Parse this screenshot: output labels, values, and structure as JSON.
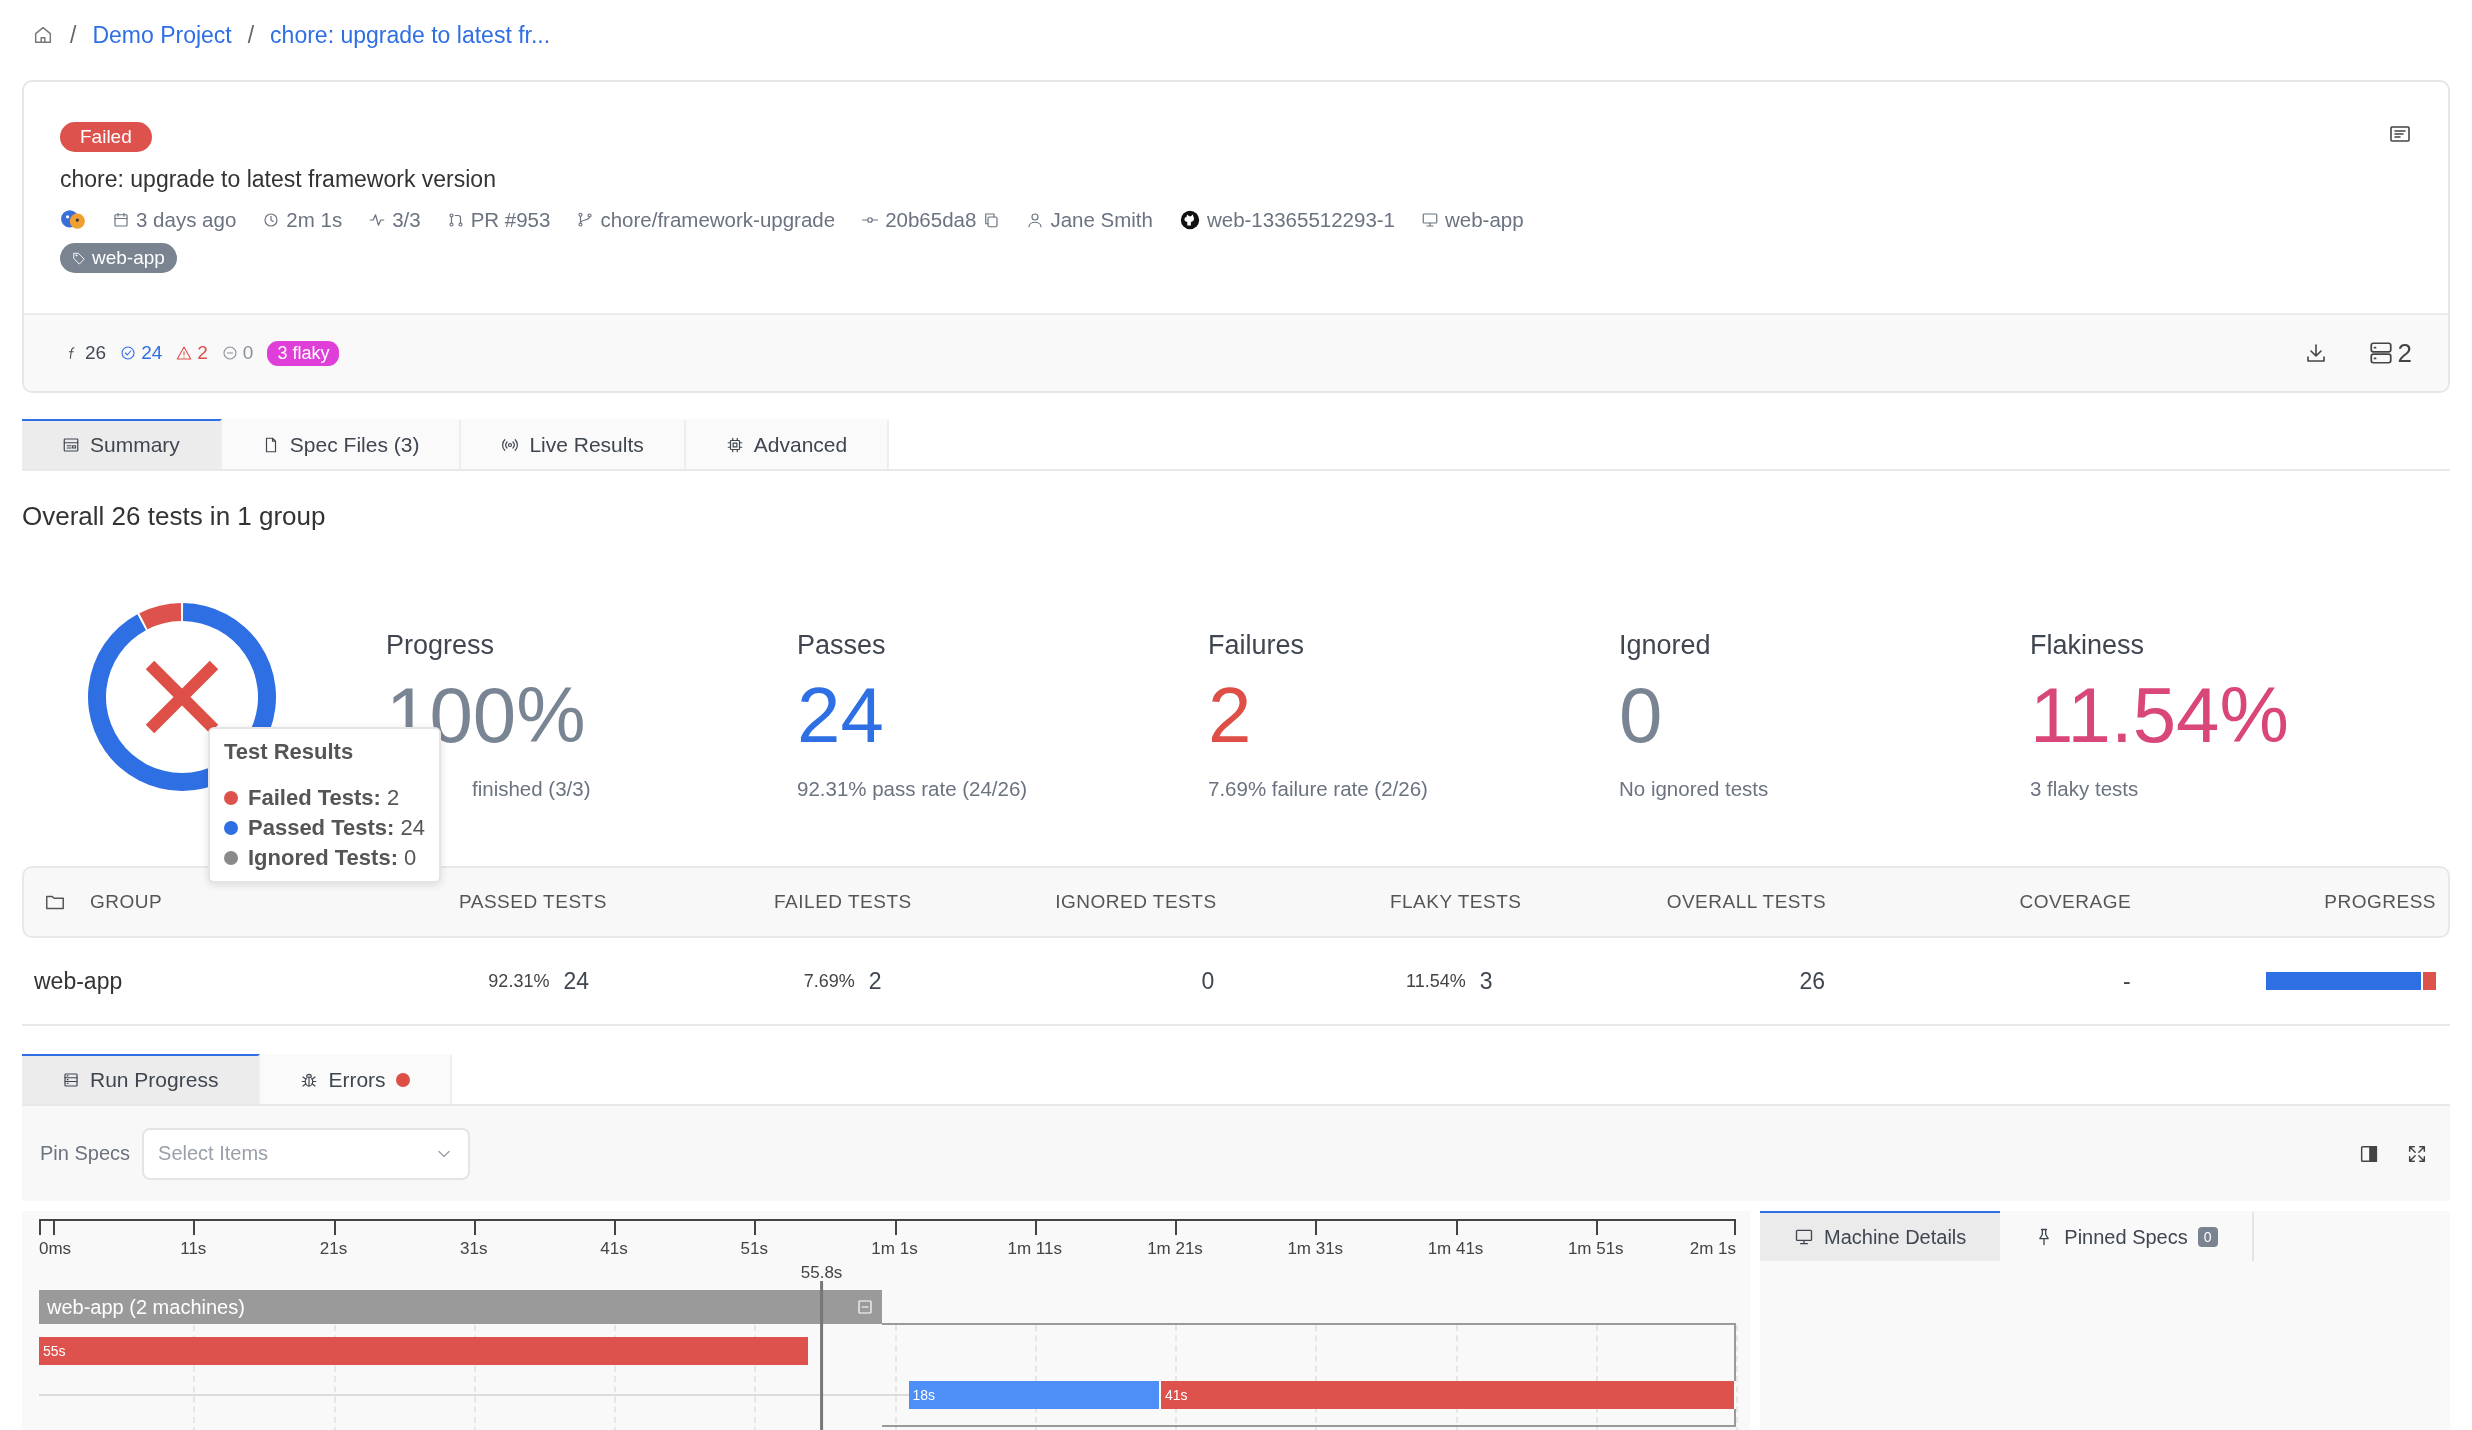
{
  "breadcrumb": [
    {
      "kind": "home"
    },
    {
      "kind": "separator",
      "text": "/"
    },
    {
      "kind": "link",
      "text": "Demo Project"
    },
    {
      "kind": "separator",
      "text": "/"
    },
    {
      "kind": "link",
      "text": "chore: upgrade to latest fr..."
    }
  ],
  "run": {
    "status": {
      "label": "Failed",
      "kind": "failed"
    },
    "title": "chore: upgrade to latest framework version",
    "meta": [
      {
        "kind": "avatar"
      },
      {
        "kind": "calendar",
        "text": "3 days ago"
      },
      {
        "kind": "clock",
        "text": "2m 1s"
      },
      {
        "kind": "activity",
        "text": "3/3"
      },
      {
        "kind": "pull-request",
        "text": "PR #953"
      },
      {
        "kind": "branch",
        "text": "chore/framework-upgrade"
      },
      {
        "kind": "commit",
        "text": "20b65da8"
      },
      {
        "kind": "user",
        "text": "Jane Smith"
      },
      {
        "kind": "github",
        "text": "web-13365512293-1"
      },
      {
        "kind": "monitor",
        "text": "web-app"
      }
    ],
    "tags": [
      "web-app"
    ],
    "counts": [
      {
        "kind": "total",
        "text": "26"
      },
      {
        "kind": "passed",
        "text": "24"
      },
      {
        "kind": "failed",
        "text": "2"
      },
      {
        "kind": "skipped",
        "text": "0"
      },
      {
        "kind": "flaky",
        "text": "3 flaky"
      }
    ],
    "machines": "2"
  },
  "tabs": [
    {
      "label": "Summary",
      "kind": "summary",
      "selected": true
    },
    {
      "label": "Spec Files (3)",
      "kind": "file",
      "selected": false
    },
    {
      "label": "Live Results",
      "kind": "live",
      "selected": false
    },
    {
      "label": "Advanced",
      "kind": "chip",
      "selected": false
    }
  ],
  "summary_heading": "Overall 26 tests in 1 group",
  "donut": {
    "chart_data": {
      "type": "donut",
      "categories": [
        "Failed Tests",
        "Passed Tests",
        "Ignored Tests"
      ],
      "values": [
        7.69,
        92.31,
        0
      ]
    }
  },
  "tooltip": {
    "title": "Test Results",
    "items": [
      {
        "sep": ":",
        "value": "2",
        "color": "#dd524c"
      },
      {
        "sep": ":",
        "value": "24",
        "color": "#2f6fe4"
      },
      {
        "sep": ":",
        "value": "0",
        "color": "#8a8a8a"
      }
    ]
  },
  "stats": [
    {
      "kind": "progress",
      "label": "Progress",
      "value": "100%",
      "detail": "finished (3/3)"
    },
    {
      "kind": "passes",
      "label": "Passes",
      "value": "24",
      "detail": "92.31% pass rate (24/26)"
    },
    {
      "kind": "failures",
      "label": "Failures",
      "value": "2",
      "detail": "7.69% failure rate (2/26)"
    },
    {
      "kind": "ignored",
      "label": "Ignored",
      "value": "0",
      "detail": "No ignored tests"
    },
    {
      "kind": "flakiness",
      "label": "Flakiness",
      "value": "11.54%",
      "detail": "3 flaky tests"
    }
  ],
  "table": {
    "columns": [
      {
        "kind": "group",
        "label": "GROUP"
      },
      {
        "kind": "value",
        "label": "PASSED TESTS"
      },
      {
        "kind": "value",
        "label": "FAILED TESTS"
      },
      {
        "kind": "value",
        "label": "IGNORED TESTS"
      },
      {
        "kind": "value",
        "label": "FLAKY TESTS"
      },
      {
        "kind": "value",
        "label": "OVERALL TESTS"
      },
      {
        "kind": "value",
        "label": "COVERAGE"
      },
      {
        "kind": "value",
        "label": "PROGRESS"
      }
    ],
    "rows": [
      {
        "cells": [
          {
            "kind": "name",
            "text": "web-app"
          },
          {
            "kind": "rate",
            "percent": "92.31%",
            "count": "24"
          },
          {
            "kind": "rate",
            "percent": "7.69%",
            "count": "2"
          },
          {
            "kind": "count",
            "text": "0"
          },
          {
            "kind": "rate",
            "percent": "11.54%",
            "count": "3"
          },
          {
            "kind": "count",
            "text": "26"
          },
          {
            "kind": "count",
            "text": "-"
          },
          {
            "kind": "progress",
            "segments": [
              {
                "level": 0.923,
                "color": "#2f6fe4"
              },
              {
                "level": 0.077,
                "color": "#dd524c"
              }
            ]
          }
        ]
      }
    ]
  },
  "bottom_tabs": [
    {
      "label": "Run Progress",
      "kind": "progress",
      "selected": true,
      "alert": false
    },
    {
      "label": "Errors",
      "kind": "errors",
      "selected": false,
      "alert": true
    }
  ],
  "pin_specs": {
    "label": "Pin Specs",
    "placeholder": "Select Items"
  },
  "timeline": {
    "group": {
      "label": "web-app (2 machines)",
      "expanded": true
    },
    "chart_data": {
      "type": "bar",
      "orientation": "horizontal",
      "stacked": true,
      "grid": true,
      "xlim": [
        0,
        121
      ],
      "xticks": [
        {
          "value": 0,
          "label": "0ms"
        },
        {
          "value": 11,
          "label": "11s"
        },
        {
          "value": 21,
          "label": "21s"
        },
        {
          "value": 31,
          "label": "31s"
        },
        {
          "value": 41,
          "label": "41s"
        },
        {
          "value": 51,
          "label": "51s"
        },
        {
          "value": 61,
          "label": "1m 1s"
        },
        {
          "value": 71,
          "label": "1m 11s"
        },
        {
          "value": 81,
          "label": "1m 21s"
        },
        {
          "value": 91,
          "label": "1m 31s"
        },
        {
          "value": 101,
          "label": "1m 41s"
        },
        {
          "value": 111,
          "label": "1m 51s"
        },
        {
          "value": 121,
          "label": "2m 1s"
        }
      ],
      "series": [
        {
          "color": "#dcdcdc",
          "values": [
            null,
            62
          ]
        },
        {
          "color": "#4e8ef7",
          "values": [
            null,
            18
          ]
        },
        {
          "color": "#dd524c",
          "values": [
            55,
            41
          ]
        }
      ],
      "ref_lines": [
        {
          "axis": "x",
          "value": 55.8,
          "label": "55.8s"
        }
      ],
      "annotations": [
        {
          "x": 0,
          "text": "55s"
        },
        {
          "x": 62,
          "text": "18s"
        },
        {
          "x": 80,
          "text": "41s"
        }
      ]
    }
  },
  "side_tabs": [
    {
      "label": "Machine Details",
      "kind": "monitor",
      "selected": true
    },
    {
      "label": "Pinned Specs",
      "kind": "pin",
      "selected": false,
      "badge": "0"
    }
  ]
}
